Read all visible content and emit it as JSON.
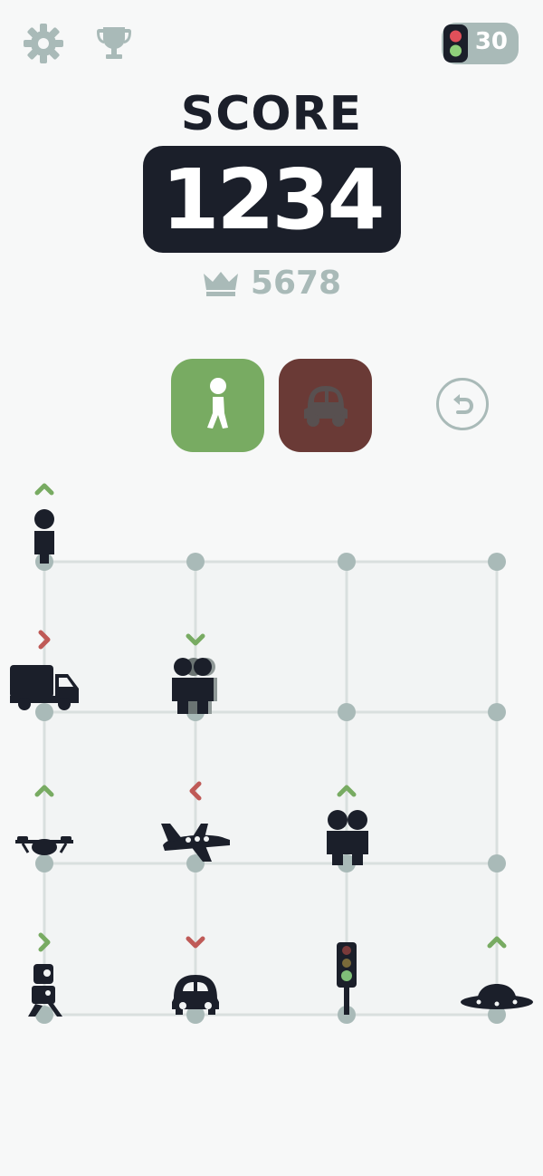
{
  "header": {
    "settings_icon": "gear-icon",
    "trophy_icon": "trophy-icon",
    "lives": {
      "icon": "traffic-light-icon",
      "count": "30"
    }
  },
  "score": {
    "title": "SCORE",
    "value": "1234"
  },
  "best": {
    "icon": "crown-icon",
    "value": "5678"
  },
  "modes": [
    {
      "name": "walk",
      "icon": "pedestrian-icon",
      "color": "#78ab62",
      "selected": true
    },
    {
      "name": "car",
      "icon": "car-icon",
      "color": "#6a3a36",
      "selected": false
    }
  ],
  "undo": {
    "icon": "undo-icon"
  },
  "colors": {
    "dark": "#1b1f2a",
    "muted": "#a9bab8",
    "green": "#78ab62",
    "red": "#bf5a57",
    "grid_line": "#d9dfde",
    "grid_node": "#a9bab8"
  },
  "board": {
    "cols": 4,
    "rows": 4,
    "pieces": [
      {
        "col": 0,
        "row": 0,
        "icon": "person-icon",
        "arrow": "up",
        "arrow_color": "green"
      },
      {
        "col": 0,
        "row": 1,
        "icon": "truck-icon",
        "arrow": "right",
        "arrow_color": "red"
      },
      {
        "col": 1,
        "row": 1,
        "icon": "crowd-icon",
        "arrow": "down",
        "arrow_color": "green"
      },
      {
        "col": 0,
        "row": 2,
        "icon": "drone-icon",
        "arrow": "up",
        "arrow_color": "green"
      },
      {
        "col": 1,
        "row": 2,
        "icon": "airplane-icon",
        "arrow": "left",
        "arrow_color": "red"
      },
      {
        "col": 2,
        "row": 2,
        "icon": "couple-icon",
        "arrow": "up",
        "arrow_color": "green"
      },
      {
        "col": 0,
        "row": 3,
        "icon": "robot-icon",
        "arrow": "right",
        "arrow_color": "green"
      },
      {
        "col": 1,
        "row": 3,
        "icon": "car-icon",
        "arrow": "down",
        "arrow_color": "red"
      },
      {
        "col": 2,
        "row": 3,
        "icon": "traffic-light-icon",
        "arrow": "",
        "arrow_color": ""
      },
      {
        "col": 3,
        "row": 3,
        "icon": "ufo-icon",
        "arrow": "up",
        "arrow_color": "green"
      }
    ]
  }
}
